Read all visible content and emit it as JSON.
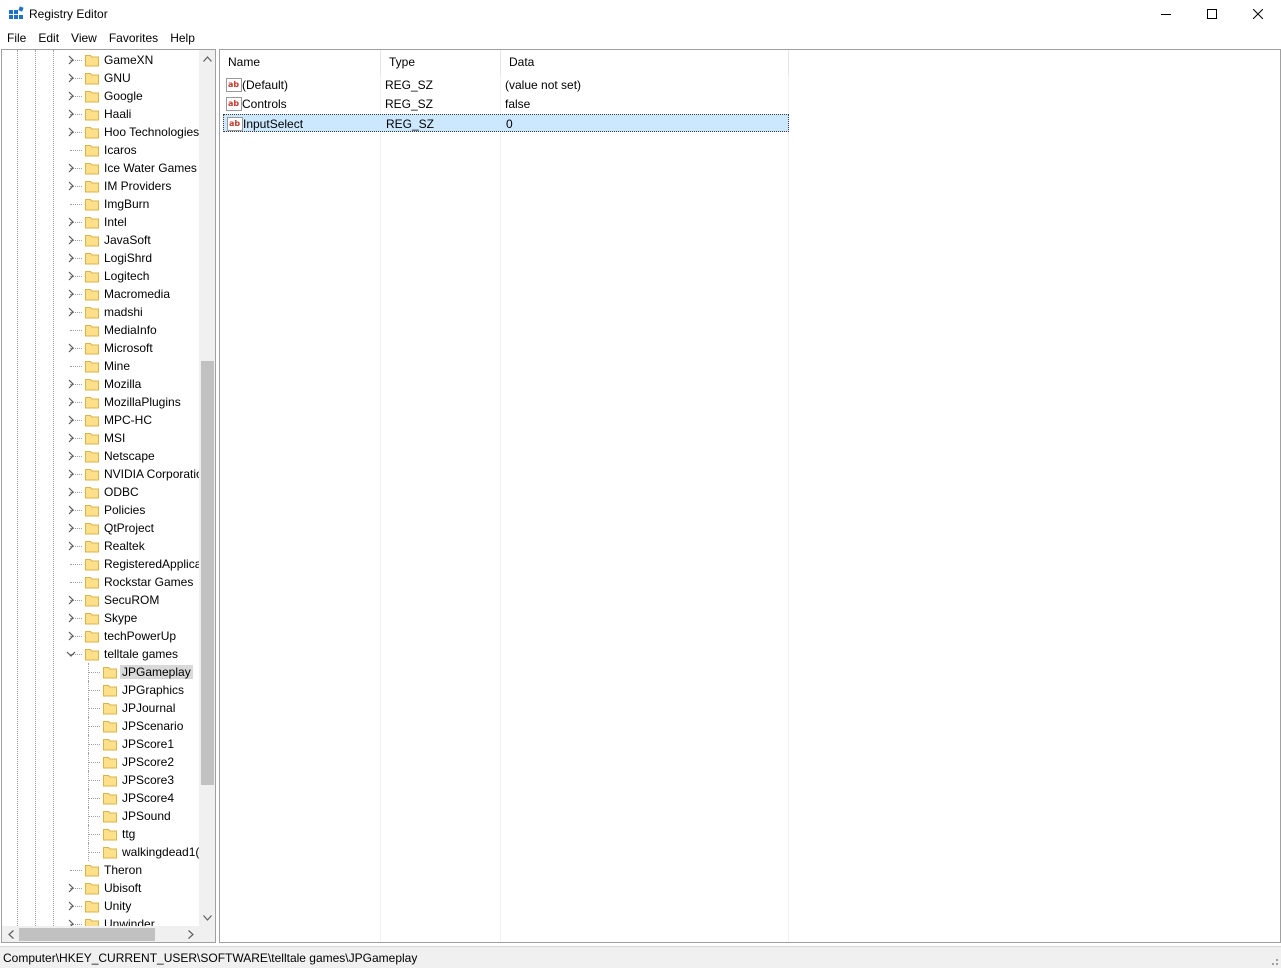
{
  "window": {
    "title": "Registry Editor"
  },
  "menu": [
    "File",
    "Edit",
    "View",
    "Favorites",
    "Help"
  ],
  "tree": {
    "items": [
      {
        "label": "GameXN",
        "depth": 0,
        "expander": "collapsed"
      },
      {
        "label": "GNU",
        "depth": 0,
        "expander": "collapsed"
      },
      {
        "label": "Google",
        "depth": 0,
        "expander": "collapsed"
      },
      {
        "label": "Haali",
        "depth": 0,
        "expander": "collapsed"
      },
      {
        "label": "Hoo Technologies",
        "depth": 0,
        "expander": "collapsed"
      },
      {
        "label": "Icaros",
        "depth": 0,
        "expander": "none"
      },
      {
        "label": "Ice Water Games",
        "depth": 0,
        "expander": "collapsed"
      },
      {
        "label": "IM Providers",
        "depth": 0,
        "expander": "collapsed"
      },
      {
        "label": "ImgBurn",
        "depth": 0,
        "expander": "none"
      },
      {
        "label": "Intel",
        "depth": 0,
        "expander": "collapsed"
      },
      {
        "label": "JavaSoft",
        "depth": 0,
        "expander": "collapsed"
      },
      {
        "label": "LogiShrd",
        "depth": 0,
        "expander": "collapsed"
      },
      {
        "label": "Logitech",
        "depth": 0,
        "expander": "collapsed"
      },
      {
        "label": "Macromedia",
        "depth": 0,
        "expander": "collapsed"
      },
      {
        "label": "madshi",
        "depth": 0,
        "expander": "collapsed"
      },
      {
        "label": "MediaInfo",
        "depth": 0,
        "expander": "none"
      },
      {
        "label": "Microsoft",
        "depth": 0,
        "expander": "collapsed"
      },
      {
        "label": "Mine",
        "depth": 0,
        "expander": "none"
      },
      {
        "label": "Mozilla",
        "depth": 0,
        "expander": "collapsed"
      },
      {
        "label": "MozillaPlugins",
        "depth": 0,
        "expander": "collapsed"
      },
      {
        "label": "MPC-HC",
        "depth": 0,
        "expander": "collapsed"
      },
      {
        "label": "MSI",
        "depth": 0,
        "expander": "collapsed"
      },
      {
        "label": "Netscape",
        "depth": 0,
        "expander": "collapsed"
      },
      {
        "label": "NVIDIA Corporatio",
        "depth": 0,
        "expander": "collapsed"
      },
      {
        "label": "ODBC",
        "depth": 0,
        "expander": "collapsed"
      },
      {
        "label": "Policies",
        "depth": 0,
        "expander": "collapsed"
      },
      {
        "label": "QtProject",
        "depth": 0,
        "expander": "collapsed"
      },
      {
        "label": "Realtek",
        "depth": 0,
        "expander": "collapsed"
      },
      {
        "label": "RegisteredApplica",
        "depth": 0,
        "expander": "none"
      },
      {
        "label": "Rockstar Games",
        "depth": 0,
        "expander": "none"
      },
      {
        "label": "SecuROM",
        "depth": 0,
        "expander": "collapsed"
      },
      {
        "label": "Skype",
        "depth": 0,
        "expander": "collapsed"
      },
      {
        "label": "techPowerUp",
        "depth": 0,
        "expander": "collapsed"
      },
      {
        "label": "telltale games",
        "depth": 0,
        "expander": "expanded"
      },
      {
        "label": "JPGameplay",
        "depth": 1,
        "expander": "none",
        "selected": true
      },
      {
        "label": "JPGraphics",
        "depth": 1,
        "expander": "none"
      },
      {
        "label": "JPJournal",
        "depth": 1,
        "expander": "none"
      },
      {
        "label": "JPScenario",
        "depth": 1,
        "expander": "none"
      },
      {
        "label": "JPScore1",
        "depth": 1,
        "expander": "none"
      },
      {
        "label": "JPScore2",
        "depth": 1,
        "expander": "none"
      },
      {
        "label": "JPScore3",
        "depth": 1,
        "expander": "none"
      },
      {
        "label": "JPScore4",
        "depth": 1,
        "expander": "none"
      },
      {
        "label": "JPSound",
        "depth": 1,
        "expander": "none"
      },
      {
        "label": "ttg",
        "depth": 1,
        "expander": "none"
      },
      {
        "label": "walkingdead1(",
        "depth": 1,
        "expander": "none"
      },
      {
        "label": "Theron",
        "depth": 0,
        "expander": "none"
      },
      {
        "label": "Ubisoft",
        "depth": 0,
        "expander": "collapsed"
      },
      {
        "label": "Unity",
        "depth": 0,
        "expander": "collapsed"
      },
      {
        "label": "Unwinder",
        "depth": 0,
        "expander": "collapsed"
      }
    ]
  },
  "list": {
    "columns": [
      "Name",
      "Type",
      "Data"
    ],
    "rows": [
      {
        "name": "(Default)",
        "type": "REG_SZ",
        "data": "(value not set)",
        "icon": "string-value-icon"
      },
      {
        "name": "Controls",
        "type": "REG_SZ",
        "data": "false",
        "icon": "string-value-icon"
      },
      {
        "name": "InputSelect",
        "type": "REG_SZ",
        "data": "0",
        "icon": "string-value-icon",
        "selected": true
      }
    ]
  },
  "status": {
    "path": "Computer\\HKEY_CURRENT_USER\\SOFTWARE\\telltale games\\JPGameplay"
  },
  "colors": {
    "folder_fill": "#ffe08a",
    "folder_stroke": "#d9b44a",
    "selection": "#cce8ff",
    "tree_selection": "#d9d9d9",
    "value_icon": "#c7392b"
  }
}
